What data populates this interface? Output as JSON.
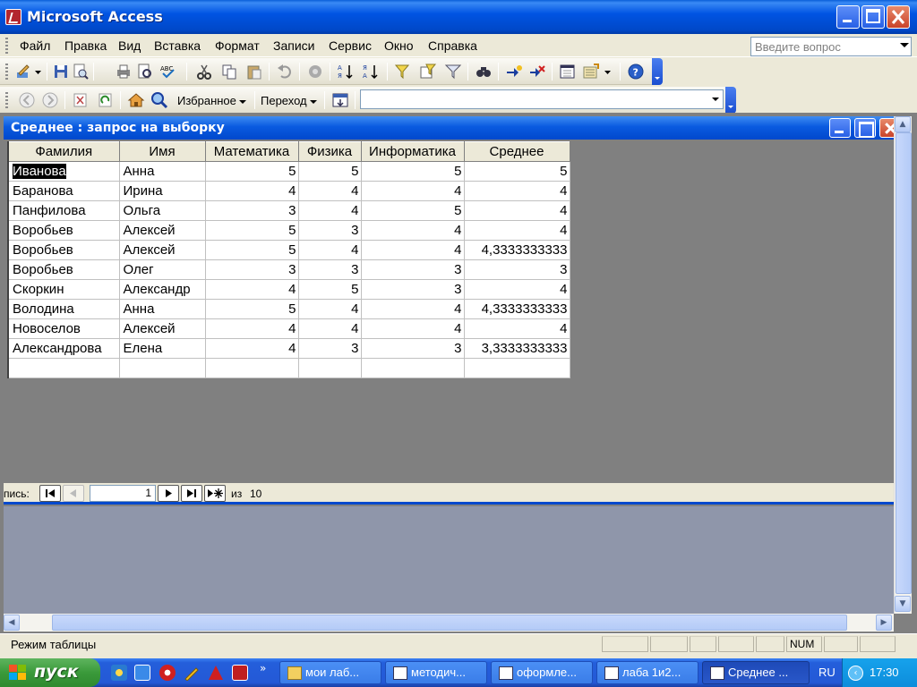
{
  "window": {
    "title": "Microsoft Access"
  },
  "menu": {
    "items": [
      "Файл",
      "Правка",
      "Вид",
      "Вставка",
      "Формат",
      "Записи",
      "Сервис",
      "Окно",
      "Справка"
    ],
    "help_placeholder": "Введите вопрос"
  },
  "web_toolbar": {
    "favorites_label": "Избранное",
    "goto_label": "Переход"
  },
  "query_window": {
    "title": "Среднее : запрос на выборку"
  },
  "datasheet": {
    "columns": [
      "Фамилия",
      "Имя",
      "Математика",
      "Физика",
      "Информатика",
      "Среднее"
    ],
    "rows": [
      [
        "Иванова",
        "Анна",
        "5",
        "5",
        "5",
        "5"
      ],
      [
        "Баранова",
        "Ирина",
        "4",
        "4",
        "4",
        "4"
      ],
      [
        "Панфилова",
        "Ольга",
        "3",
        "4",
        "5",
        "4"
      ],
      [
        "Воробьев",
        "Алексей",
        "5",
        "3",
        "4",
        "4"
      ],
      [
        "Воробьев",
        "Алексей",
        "5",
        "4",
        "4",
        "4,3333333333"
      ],
      [
        "Воробьев",
        "Олег",
        "3",
        "3",
        "3",
        "3"
      ],
      [
        "Скоркин",
        "Александр",
        "4",
        "5",
        "3",
        "4"
      ],
      [
        "Володина",
        "Анна",
        "5",
        "4",
        "4",
        "4,3333333333"
      ],
      [
        "Новоселов",
        "Алексей",
        "4",
        "4",
        "4",
        "4"
      ],
      [
        "Александрова",
        "Елена",
        "4",
        "3",
        "3",
        "3,3333333333"
      ]
    ]
  },
  "navigation": {
    "label": "пись:",
    "current_record": "1",
    "of_label": "из",
    "total": "10"
  },
  "status": {
    "mode": "Режим таблицы",
    "num": "NUM"
  },
  "taskbar": {
    "start_label": "пуск",
    "tasks": [
      "мои лаб...",
      "методич...",
      "оформле...",
      "лаба 1и2...",
      "Среднее ..."
    ],
    "language": "RU",
    "clock": "17:30"
  }
}
